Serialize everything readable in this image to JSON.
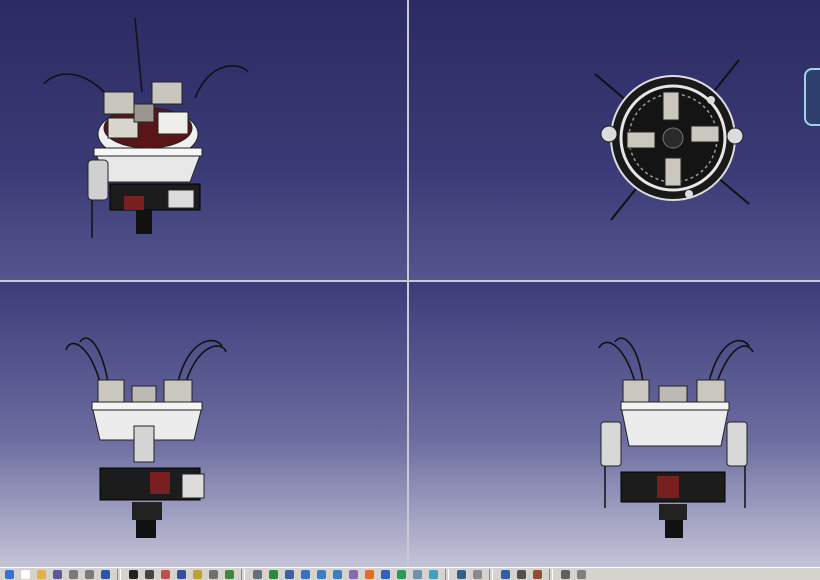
{
  "viewports": [
    {
      "id": "isometric",
      "icon": "isometric-view"
    },
    {
      "id": "top",
      "icon": "top-view"
    },
    {
      "id": "front",
      "icon": "front-view"
    },
    {
      "id": "side",
      "icon": "side-view"
    }
  ],
  "colors": {
    "background_top": "#2c2b63",
    "background_bottom": "#c4c4d8",
    "splitter": "#c9c9d6",
    "toolbar": "#d6d3ce",
    "model_body": "#e6e6e6",
    "model_dark": "#1a1a1a",
    "model_accent": "#7a1f1f"
  },
  "toolbar": {
    "groups": [
      [
        {
          "icon": "select-arrow-icon",
          "color": "#3a6fd8"
        },
        {
          "icon": "new-document-icon",
          "color": "#ffffff"
        },
        {
          "icon": "open-folder-icon",
          "color": "#e0b24a"
        },
        {
          "icon": "save-icon",
          "color": "#5a5a9a"
        },
        {
          "icon": "undo-icon",
          "color": "#7a7a7a"
        },
        {
          "icon": "redo-icon",
          "color": "#7a7a7a"
        },
        {
          "icon": "help-icon",
          "color": "#2a55a8"
        }
      ],
      [
        {
          "icon": "sketch-curve-icon",
          "color": "#222222"
        },
        {
          "icon": "rotate-icon",
          "color": "#444444"
        },
        {
          "icon": "measure-icon",
          "color": "#c05050"
        },
        {
          "icon": "table-icon",
          "color": "#3050a0"
        },
        {
          "icon": "constraint-icon",
          "color": "#c0a030"
        },
        {
          "icon": "bolt-icon",
          "color": "#707070"
        },
        {
          "icon": "part-icon",
          "color": "#3a8a3a"
        }
      ],
      [
        {
          "icon": "fly-mode-icon",
          "color": "#607080"
        },
        {
          "icon": "fit-all-icon",
          "color": "#2a8a3a"
        },
        {
          "icon": "pan-icon",
          "color": "#4060a0"
        },
        {
          "icon": "rotate-view-icon",
          "color": "#3a70c0"
        },
        {
          "icon": "zoom-in-icon",
          "color": "#3a80c0"
        },
        {
          "icon": "zoom-out-icon",
          "color": "#3a80c0"
        },
        {
          "icon": "normal-view-icon",
          "color": "#8a6ab0"
        },
        {
          "icon": "multi-view-icon",
          "color": "#e07020"
        },
        {
          "icon": "iso-view-icon",
          "color": "#3060c0"
        },
        {
          "icon": "shading-icon",
          "color": "#2a9a5a"
        },
        {
          "icon": "hide-show-icon",
          "color": "#7090b0"
        },
        {
          "icon": "swap-space-icon",
          "color": "#40a0c0"
        }
      ],
      [
        {
          "icon": "render-icon",
          "color": "#306090"
        },
        {
          "icon": "material-icon",
          "color": "#8a8a8a"
        }
      ],
      [
        {
          "icon": "measure-between-icon",
          "color": "#3060a0"
        },
        {
          "icon": "measure-item-icon",
          "color": "#505050"
        },
        {
          "icon": "apply-material-icon",
          "color": "#905030"
        }
      ],
      [
        {
          "icon": "tools-icon",
          "color": "#606060"
        },
        {
          "icon": "settings-icon",
          "color": "#808080"
        }
      ]
    ]
  }
}
